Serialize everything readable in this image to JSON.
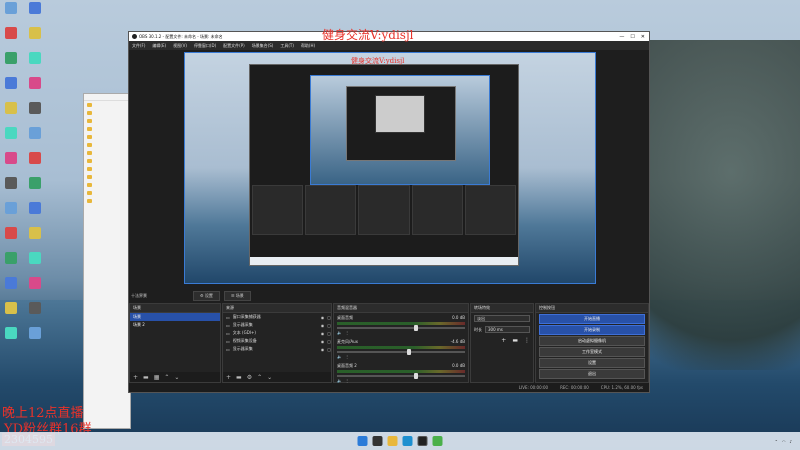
{
  "desktop": {
    "icons": [
      {
        "label": "",
        "color": "#6aa0d8"
      },
      {
        "label": "",
        "color": "#d84a4a"
      },
      {
        "label": "",
        "color": "#3aa06a"
      },
      {
        "label": "",
        "color": "#4a7ad8"
      },
      {
        "label": "",
        "color": "#d8c04a"
      },
      {
        "label": "",
        "color": "#4ad8c0"
      },
      {
        "label": "",
        "color": "#d84a8a"
      },
      {
        "label": "",
        "color": "#5a5a5a"
      }
    ]
  },
  "explorer": {
    "title": "",
    "items": [
      "",
      "",
      "",
      "",
      "",
      "",
      "",
      "",
      "",
      "",
      "",
      "",
      ""
    ]
  },
  "obs": {
    "window_title": "OBS 30.1.2 - 配置文件: 未命名 - 场景: 未命名",
    "menu": [
      "文件(F)",
      "编辑(E)",
      "视图(V)",
      "停靠窗口(D)",
      "配置文件(P)",
      "场景集合(S)",
      "工具(T)",
      "帮助(H)"
    ],
    "scene_tabs": {
      "label": "十法界景",
      "btn1": "⚙ 设置",
      "btn2": "☰ 场景"
    },
    "docks": {
      "scenes": {
        "title": "场景",
        "items": [
          "场景",
          "场景 2"
        ],
        "active_index": 0
      },
      "sources": {
        "title": "来源",
        "items": [
          "窗口采集捕获器",
          "显示器采集",
          "文本 (GDI+)",
          "视频采集设备",
          "显示器采集"
        ]
      },
      "mixer": {
        "title": "音频混音器",
        "tracks": [
          {
            "name": "桌面音频",
            "db": "0.0 dB",
            "level": 0.6
          },
          {
            "name": "麦克风/Aux",
            "db": "-4.6 dB",
            "level": 0.55
          },
          {
            "name": "桌面音频 2",
            "db": "0.0 dB",
            "level": 0.6
          }
        ]
      },
      "transitions": {
        "title": "转场特效",
        "type": "淡出",
        "duration_label": "时长",
        "duration": "300 ms"
      },
      "controls": {
        "title": "控制按钮",
        "buttons": [
          "开始直播",
          "开始录制",
          "启动虚拟摄像机",
          "工作室模式",
          "设置",
          "退出"
        ]
      }
    },
    "status": {
      "live": "LIVE: 00:00:00",
      "rec": "REC: 00:00:00",
      "cpu": "CPU: 1.2%, 60.00 fps"
    }
  },
  "watermarks": {
    "top_right": "健身交流V:ydisjl",
    "preview_inner": "健身交流V:ydisjl",
    "bottom_left_line1": "晚上12点直播",
    "bottom_left_line2": "YD粉丝群16群",
    "bottom_left_line3": "2304595"
  },
  "taskbar": {
    "clock_time": "",
    "clock_date": ""
  }
}
